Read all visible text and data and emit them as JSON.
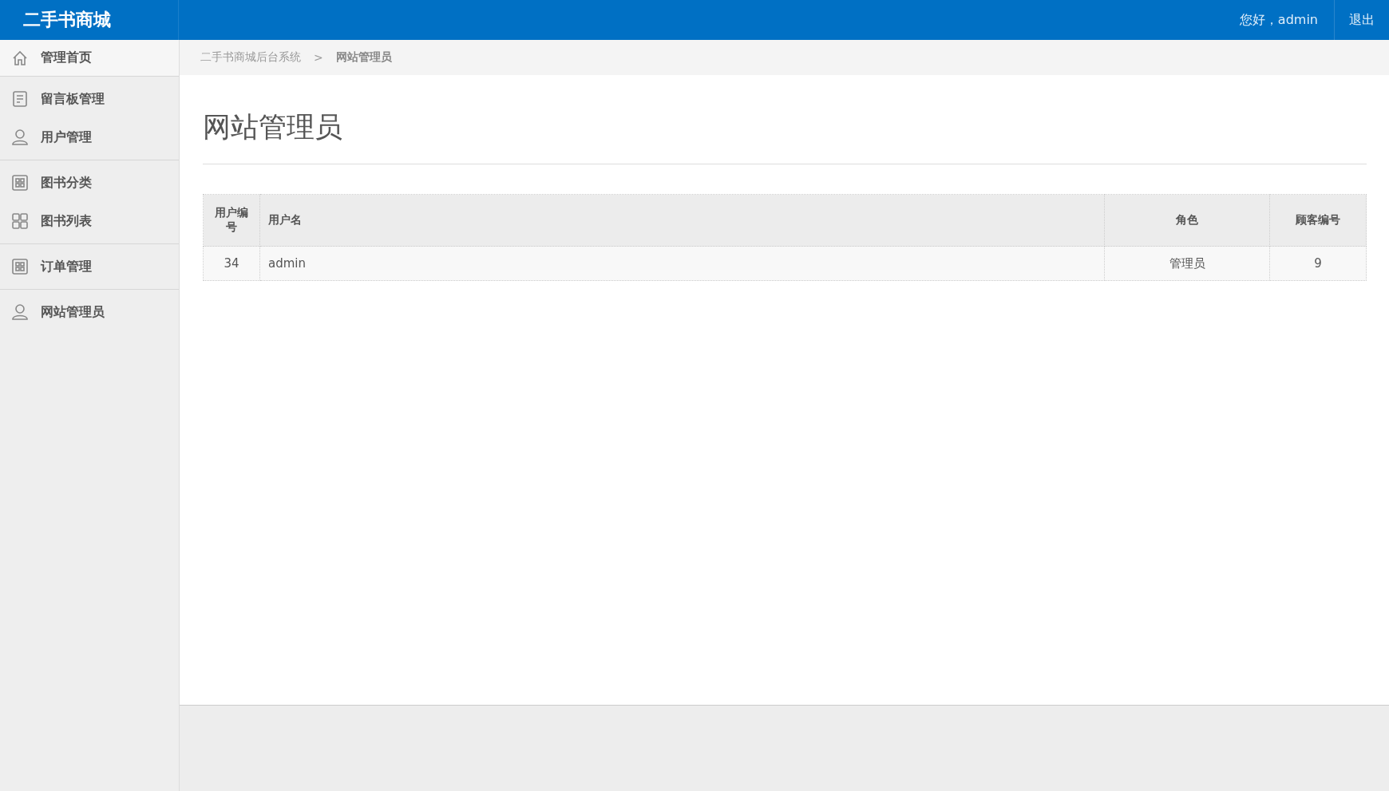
{
  "header": {
    "brand": "二手书商城",
    "greeting": "您好，admin",
    "logout": "退出"
  },
  "sidebar": {
    "groups": [
      {
        "items": [
          {
            "label": "管理首页",
            "kind": "home",
            "selected": true
          }
        ]
      },
      {
        "items": [
          {
            "label": "留言板管理",
            "kind": "doc",
            "selected": false
          },
          {
            "label": "用户管理",
            "kind": "user",
            "selected": false
          }
        ]
      },
      {
        "items": [
          {
            "label": "图书分类",
            "kind": "boxgrid",
            "selected": false
          },
          {
            "label": "图书列表",
            "kind": "grid",
            "selected": false
          }
        ]
      },
      {
        "items": [
          {
            "label": "订单管理",
            "kind": "boxgrid",
            "selected": false
          }
        ]
      },
      {
        "items": [
          {
            "label": "网站管理员",
            "kind": "user",
            "selected": false
          }
        ]
      }
    ]
  },
  "breadcrumb": {
    "items": [
      "二手书商城后台系统",
      "网站管理员"
    ],
    "separator": ">"
  },
  "page_title": "网站管理员",
  "table": {
    "columns": [
      "用户编号",
      "用户名",
      "角色",
      "顾客编号"
    ],
    "rows": [
      [
        "34",
        "admin",
        "管理员",
        "9"
      ]
    ]
  }
}
